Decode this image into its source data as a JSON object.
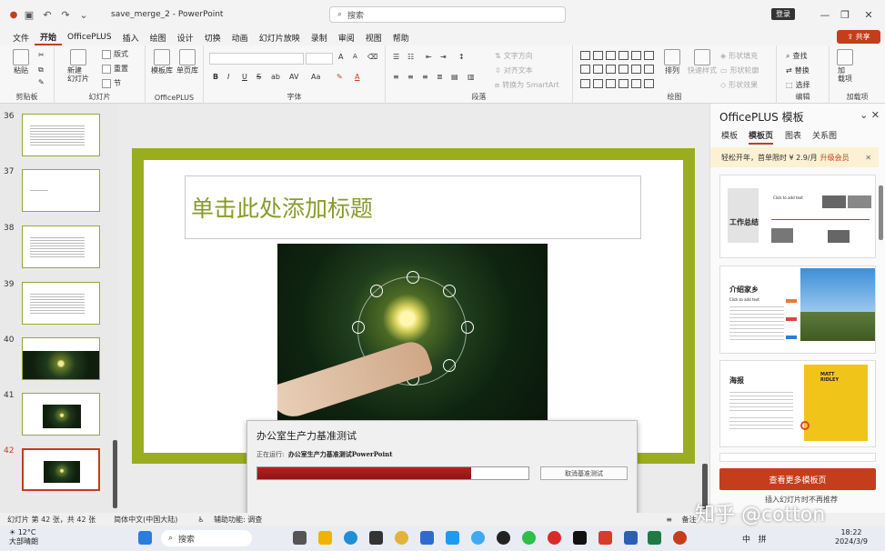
{
  "titlebar": {
    "doc_name": "save_merge_2",
    "separator": "-",
    "app": "PowerPoint",
    "search_placeholder": "搜索",
    "login": "登录"
  },
  "menu": {
    "items": [
      "文件",
      "开始",
      "OfficePLUS",
      "插入",
      "绘图",
      "设计",
      "切换",
      "动画",
      "幻灯片放映",
      "录制",
      "审阅",
      "视图",
      "帮助"
    ],
    "active": "开始",
    "share": "共享"
  },
  "ribbon": {
    "clipboard": {
      "paste": "粘贴",
      "label": "剪贴板"
    },
    "slides": {
      "new_slide": "新建\n幻灯片",
      "layout": "版式",
      "reset": "重置",
      "section": "节",
      "label": "幻灯片"
    },
    "officeplus": {
      "templates": "模板库",
      "single": "单页库",
      "label": "OfficePLUS"
    },
    "font": {
      "label": "字体",
      "bold": "B",
      "italic": "I",
      "underline": "U",
      "strike": "S",
      "shadow": "ab",
      "spacing": "AV",
      "case": "Aa",
      "grow": "A",
      "shrink": "A"
    },
    "paragraph": {
      "text_direction": "文字方向",
      "align_text": "对齐文本",
      "smartart": "转换为 SmartArt",
      "label": "段落"
    },
    "drawing": {
      "arrange": "排列",
      "quick_styles": "快速样式",
      "fill": "形状填充",
      "outline": "形状轮廓",
      "effects": "形状效果",
      "label": "绘图"
    },
    "editing": {
      "find": "查找",
      "replace": "替换",
      "select": "选择",
      "label": "编辑"
    },
    "addins": {
      "addins": "加\n载项",
      "label": "加载项"
    }
  },
  "thumbnails": {
    "numbers": [
      "36",
      "37",
      "38",
      "39",
      "40",
      "41",
      "42"
    ],
    "selected": "42"
  },
  "slide": {
    "title_placeholder": "单击此处添加标题"
  },
  "dialog": {
    "title": "办公室生产力基准测试",
    "status_prefix": "正在运行:",
    "status_value": "办公室生产力基准测试PowerPoint",
    "progress": 0.79,
    "cancel": "取消基准测试"
  },
  "right_pane": {
    "title": "OfficePLUS 模板",
    "tabs": [
      "模板",
      "模板页",
      "图表",
      "关系图"
    ],
    "active_tab": "模板页",
    "promo_text": "轻松开年，首单限时 ¥ 2.9/月",
    "promo_vip": "升级会员",
    "cards": [
      {
        "title": "工作总结",
        "text": "Click to add text"
      },
      {
        "title": "介绍家乡",
        "text": "Click to add text"
      },
      {
        "title": "海报",
        "text": "MATT RIDLEY"
      }
    ],
    "more_button": "查看更多模板页",
    "footer": "插入幻灯片时不再推荐"
  },
  "statusbar": {
    "slide_info": "幻灯片 第 42 张，共 42 张",
    "language": "简体中文(中国大陆)",
    "accessibility": "辅助功能: 调查",
    "notes": "备注"
  },
  "taskbar": {
    "temp": "12°C",
    "weather": "大部晴朗",
    "search": "搜索",
    "ime1": "中",
    "ime2": "拼",
    "time": "18:22",
    "date": "2024/3/9"
  },
  "watermark": "知乎 @cotton",
  "colors": {
    "accent": "#c43e1c",
    "slide_border": "#9aad1f",
    "progress": "#b81f1f"
  }
}
